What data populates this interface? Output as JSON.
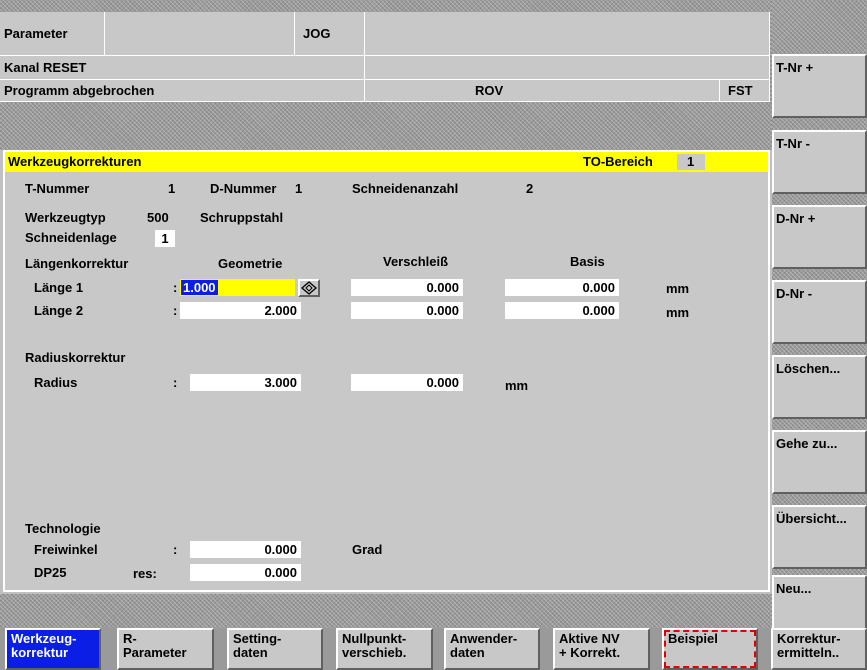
{
  "header": {
    "area": "Parameter",
    "mode": "JOG",
    "channel_status": "Kanal RESET",
    "program_status": "Programm abgebrochen",
    "rov": "ROV",
    "fst": "FST"
  },
  "panel": {
    "title": "Werkzeugkorrekturen",
    "to_bereich_label": "TO-Bereich",
    "to_bereich_value": "1",
    "t_nummer_label": "T-Nummer",
    "t_nummer_value": "1",
    "d_nummer_label": "D-Nummer",
    "d_nummer_value": "1",
    "schneidenanzahl_label": "Schneidenanzahl",
    "schneidenanzahl_value": "2",
    "werkzeugtyp_label": "Werkzeugtyp",
    "werkzeugtyp_value": "500",
    "werkzeugtyp_name": "Schruppstahl",
    "schneidenlage_label": "Schneidenlage",
    "schneidenlage_value": "1",
    "laengenkorrektur_label": "Längenkorrektur",
    "col_geometrie": "Geometrie",
    "col_verschleiss": "Verschleiß",
    "col_basis": "Basis",
    "laenge1": {
      "label": "Länge 1",
      "colon": ":",
      "geometrie": "1.000",
      "verschleiss": "0.000",
      "basis": "0.000",
      "unit": "mm"
    },
    "laenge2": {
      "label": "Länge 2",
      "colon": ":",
      "geometrie": "2.000",
      "verschleiss": "0.000",
      "basis": "0.000",
      "unit": "mm"
    },
    "radiuskorrektur_label": "Radiuskorrektur",
    "radius": {
      "label": "Radius",
      "colon": ":",
      "geometrie": "3.000",
      "verschleiss": "0.000",
      "unit": "mm"
    },
    "technologie_label": "Technologie",
    "freiwinkel": {
      "label": "Freiwinkel",
      "colon": ":",
      "value": "0.000",
      "unit": "Grad"
    },
    "dp25": {
      "label": "DP25",
      "res": "res:",
      "value": "0.000"
    }
  },
  "softkeys_vertical": [
    "T-Nr +",
    "T-Nr -",
    "D-Nr +",
    "D-Nr -",
    "Löschen...",
    "Gehe zu...",
    "Übersicht...",
    "Neu..."
  ],
  "softkeys_horizontal": [
    "Werkzeug-\nkorrektur",
    "R-\nParameter",
    "Setting-\ndaten",
    "Nullpunkt-\nverschieb.",
    "Anwender-\ndaten",
    "Aktive NV\n+ Korrekt.",
    "Beispiel",
    "Korrektur-\nermitteln.."
  ],
  "colors": {
    "title_bar": "#ffff00",
    "active_softkey": "#0a1ee6",
    "highlight_marker": "#e00000"
  }
}
